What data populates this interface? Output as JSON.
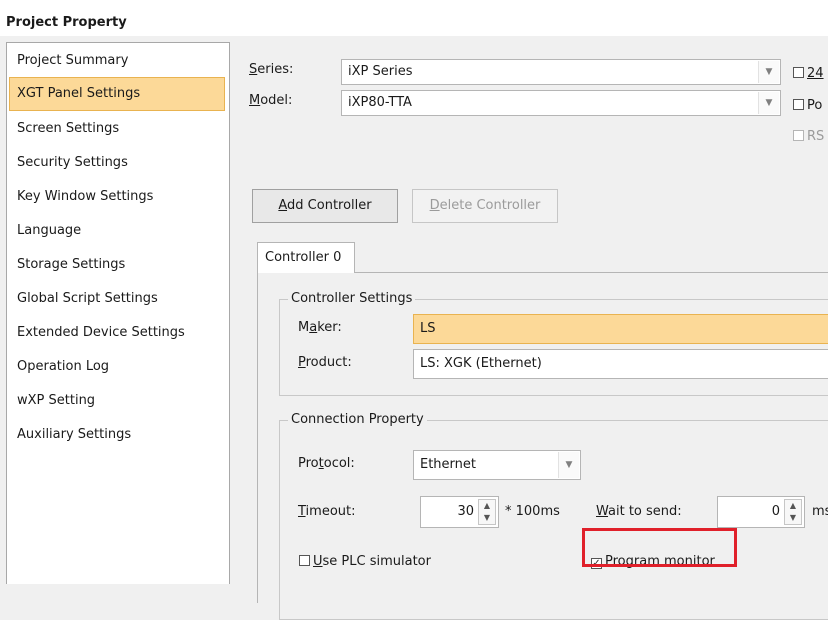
{
  "window": {
    "title": "Project Property"
  },
  "sidebar": {
    "items": [
      {
        "label": "Project Summary",
        "selected": false
      },
      {
        "label": "XGT Panel Settings",
        "selected": true
      },
      {
        "label": "Screen Settings",
        "selected": false
      },
      {
        "label": "Security Settings",
        "selected": false
      },
      {
        "label": "Key Window Settings",
        "selected": false
      },
      {
        "label": "Language",
        "selected": false
      },
      {
        "label": "Storage Settings",
        "selected": false
      },
      {
        "label": "Global Script Settings",
        "selected": false
      },
      {
        "label": "Extended Device Settings",
        "selected": false
      },
      {
        "label": "Operation Log",
        "selected": false
      },
      {
        "label": "wXP Setting",
        "selected": false
      },
      {
        "label": "Auxiliary Settings",
        "selected": false
      }
    ]
  },
  "panel": {
    "series": {
      "mnemonic": "S",
      "rest": "eries:",
      "value": "iXP Series"
    },
    "model": {
      "mnemonic": "M",
      "rest": "odel:",
      "value": "iXP80-TTA"
    },
    "right_checks": [
      {
        "label": "24",
        "checked": false,
        "disabled": false
      },
      {
        "label": "Po",
        "checked": false,
        "disabled": false
      },
      {
        "label": "RS",
        "checked": false,
        "disabled": true
      }
    ],
    "add_controller": {
      "mnemonic": "A",
      "rest": "dd Controller"
    },
    "delete_controller": {
      "mnemonic": "D",
      "rest": "elete Controller"
    },
    "tab_label": "Controller 0",
    "controller_settings": {
      "title": "Controller Settings",
      "maker": {
        "pre": "M",
        "mnemonic": "a",
        "rest": "ker:",
        "value": "LS"
      },
      "product": {
        "mnemonic": "P",
        "rest": "roduct:",
        "value": "LS: XGK (Ethernet)"
      }
    },
    "connection": {
      "title": "Connection Property",
      "protocol": {
        "pre": "Pro",
        "mnemonic": "t",
        "rest": "ocol:",
        "value": "Ethernet"
      },
      "timeout": {
        "mnemonic": "T",
        "rest": "imeout:",
        "value": "30",
        "unit": "* 100ms"
      },
      "wait": {
        "mnemonic": "W",
        "rest": "ait to send:",
        "value": "0",
        "unit": "ms"
      },
      "use_simulator": {
        "mnemonic": "U",
        "rest": "se PLC simulator",
        "checked": false
      },
      "program_monitor": {
        "pre": "Pr",
        "mnemonic": "o",
        "rest": "gram monitor",
        "checked": true
      }
    },
    "highlight_color": "#e0202a"
  }
}
